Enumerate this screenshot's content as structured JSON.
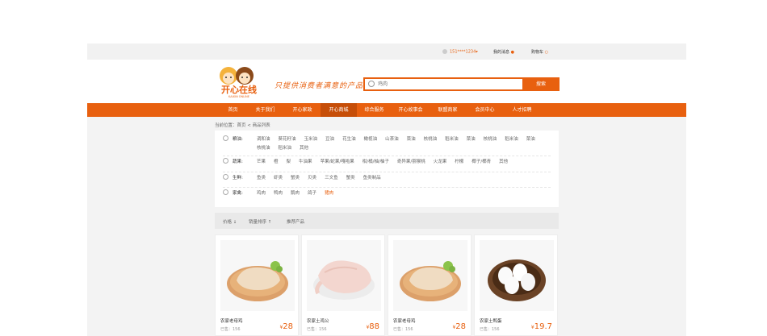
{
  "topbar": {
    "phone": "151****1234",
    "phone_arrow": "▾",
    "messages": "我的消息",
    "cart": "购物车"
  },
  "header": {
    "logo_text": "开心在线",
    "logo_sub": "KAIXIN ONLINE",
    "slogan": "只提供消费者满意的产品",
    "search_placeholder": "鸡肉",
    "search_button": "搜索"
  },
  "nav": [
    {
      "label": "首页",
      "active": false
    },
    {
      "label": "关于我们",
      "active": false
    },
    {
      "label": "开心家政",
      "active": false
    },
    {
      "label": "开心商城",
      "active": true
    },
    {
      "label": "综合服务",
      "active": false
    },
    {
      "label": "开心故事会",
      "active": false
    },
    {
      "label": "联盟商家",
      "active": false
    },
    {
      "label": "会员中心",
      "active": false
    },
    {
      "label": "人才招聘",
      "active": false
    }
  ],
  "breadcrumb": "当前位置：首页 < 商品列表",
  "filters": [
    {
      "label": "粮油:",
      "options": [
        "调和油",
        "葵花籽油",
        "玉米油",
        "豆油",
        "花生油",
        "橄榄油",
        "山茶油",
        "菜油",
        "核桃油",
        "稻米油",
        "菜油",
        "核桃油",
        "稻米油",
        "菜油",
        "核桃油",
        "稻米油",
        "其他"
      ],
      "selected": -1
    },
    {
      "label": "蔬果:",
      "options": [
        "芒果",
        "橙",
        "梨",
        "牛油果",
        "苹果/蛇果/嘎啦果",
        "柑/橘/柚/柚子",
        "奇异果/猕猴桃",
        "火龙果",
        "柠檬",
        "椰子/椰青",
        "其他"
      ],
      "selected": -1
    },
    {
      "label": "生鲜:",
      "options": [
        "鱼类",
        "虾类",
        "蟹类",
        "贝类",
        "三文鱼",
        "蟹类",
        "鱼类制品"
      ],
      "selected": -1
    },
    {
      "label": "家禽:",
      "options": [
        "鸡肉",
        "鸭肉",
        "鹅肉",
        "鸽子",
        "猪肉"
      ],
      "selected": 4
    }
  ],
  "sort": {
    "price": "价格",
    "price_arrow": "↓",
    "sales": "销量排序",
    "sales_arrow": "↑",
    "recommend": "推荐产品"
  },
  "products": [
    {
      "name": "农家老母鸡",
      "sold": "已售：156",
      "currency": "¥",
      "price": "28",
      "image": "roast-chicken-on-board"
    },
    {
      "name": "农家土鸡公",
      "sold": "已售：156",
      "currency": "¥",
      "price": "88",
      "image": "raw-chicken"
    },
    {
      "name": "农家老母鸡",
      "sold": "已售：156",
      "currency": "¥",
      "price": "28",
      "image": "roast-chicken-on-board"
    },
    {
      "name": "农家土鸭蛋",
      "sold": "已售：156",
      "currency": "¥",
      "price": "19.7",
      "image": "duck-eggs-basket"
    }
  ],
  "colors": {
    "accent": "#e8600f",
    "nav_active": "#c64e08"
  }
}
